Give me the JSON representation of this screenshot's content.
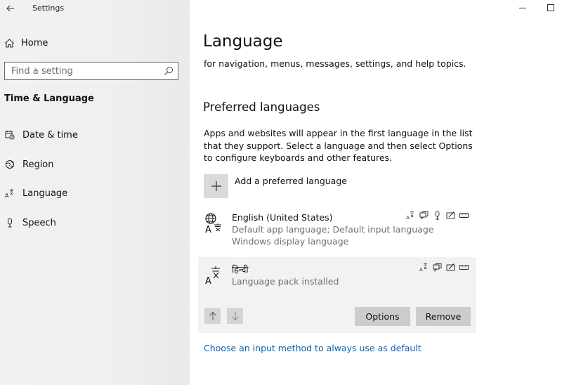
{
  "app": {
    "title": "Settings"
  },
  "sidebar": {
    "home_label": "Home",
    "search_placeholder": "Find a setting",
    "section_title": "Time & Language",
    "items": [
      {
        "label": "Date & time",
        "icon": "calendar-clock-icon"
      },
      {
        "label": "Region",
        "icon": "globe-icon"
      },
      {
        "label": "Language",
        "icon": "language-icon"
      },
      {
        "label": "Speech",
        "icon": "microphone-icon"
      }
    ]
  },
  "main": {
    "title": "Language",
    "subtitle": "for navigation, menus, messages, settings, and help topics.",
    "preferred_heading": "Preferred languages",
    "preferred_description": "Apps and websites will appear in the first language in the list that they support. Select a language and then select Options to configure keyboards and other features.",
    "add_label": "Add a preferred language",
    "languages": [
      {
        "name": "English (United States)",
        "detail_line1": "Default app language; Default input language",
        "detail_line2": "Windows display language"
      },
      {
        "name": "हिन्दी",
        "detail_line1": "Language pack installed"
      }
    ],
    "options_label": "Options",
    "remove_label": "Remove",
    "input_method_link": "Choose an input method to always use as default"
  },
  "colors": {
    "link": "#0a63b4",
    "selected_bg": "#f2f2f2",
    "button_bg": "#cccccc"
  }
}
